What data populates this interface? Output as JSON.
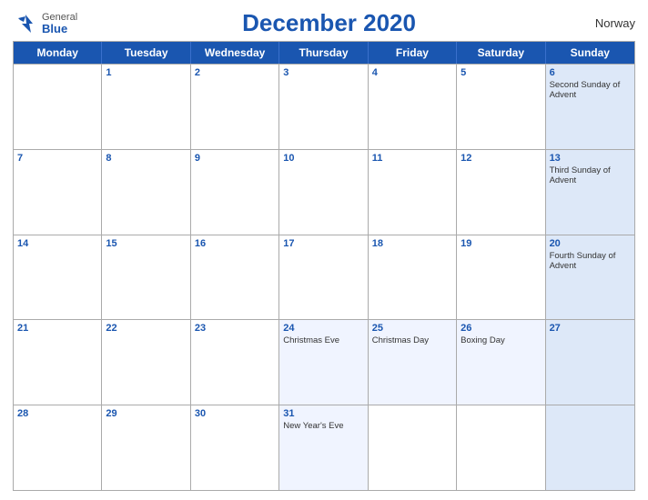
{
  "logo": {
    "general": "General",
    "blue": "Blue"
  },
  "title": "December 2020",
  "country": "Norway",
  "header": {
    "days": [
      "Monday",
      "Tuesday",
      "Wednesday",
      "Thursday",
      "Friday",
      "Saturday",
      "Sunday"
    ]
  },
  "weeks": [
    [
      {
        "num": "",
        "holiday": ""
      },
      {
        "num": "1",
        "holiday": ""
      },
      {
        "num": "2",
        "holiday": ""
      },
      {
        "num": "3",
        "holiday": ""
      },
      {
        "num": "4",
        "holiday": ""
      },
      {
        "num": "5",
        "holiday": ""
      },
      {
        "num": "6",
        "holiday": "Second Sunday of Advent"
      }
    ],
    [
      {
        "num": "7",
        "holiday": ""
      },
      {
        "num": "8",
        "holiday": ""
      },
      {
        "num": "9",
        "holiday": ""
      },
      {
        "num": "10",
        "holiday": ""
      },
      {
        "num": "11",
        "holiday": ""
      },
      {
        "num": "12",
        "holiday": ""
      },
      {
        "num": "13",
        "holiday": "Third Sunday of Advent"
      }
    ],
    [
      {
        "num": "14",
        "holiday": ""
      },
      {
        "num": "15",
        "holiday": ""
      },
      {
        "num": "16",
        "holiday": ""
      },
      {
        "num": "17",
        "holiday": ""
      },
      {
        "num": "18",
        "holiday": ""
      },
      {
        "num": "19",
        "holiday": ""
      },
      {
        "num": "20",
        "holiday": "Fourth Sunday of Advent"
      }
    ],
    [
      {
        "num": "21",
        "holiday": ""
      },
      {
        "num": "22",
        "holiday": ""
      },
      {
        "num": "23",
        "holiday": ""
      },
      {
        "num": "24",
        "holiday": "Christmas Eve"
      },
      {
        "num": "25",
        "holiday": "Christmas Day"
      },
      {
        "num": "26",
        "holiday": "Boxing Day"
      },
      {
        "num": "27",
        "holiday": ""
      }
    ],
    [
      {
        "num": "28",
        "holiday": ""
      },
      {
        "num": "29",
        "holiday": ""
      },
      {
        "num": "30",
        "holiday": ""
      },
      {
        "num": "31",
        "holiday": "New Year's Eve"
      },
      {
        "num": "",
        "holiday": ""
      },
      {
        "num": "",
        "holiday": ""
      },
      {
        "num": "",
        "holiday": ""
      }
    ]
  ],
  "colors": {
    "blue": "#1a56b0",
    "sunday_bg": "#dde8f8",
    "header_bg": "#1a56b0"
  }
}
